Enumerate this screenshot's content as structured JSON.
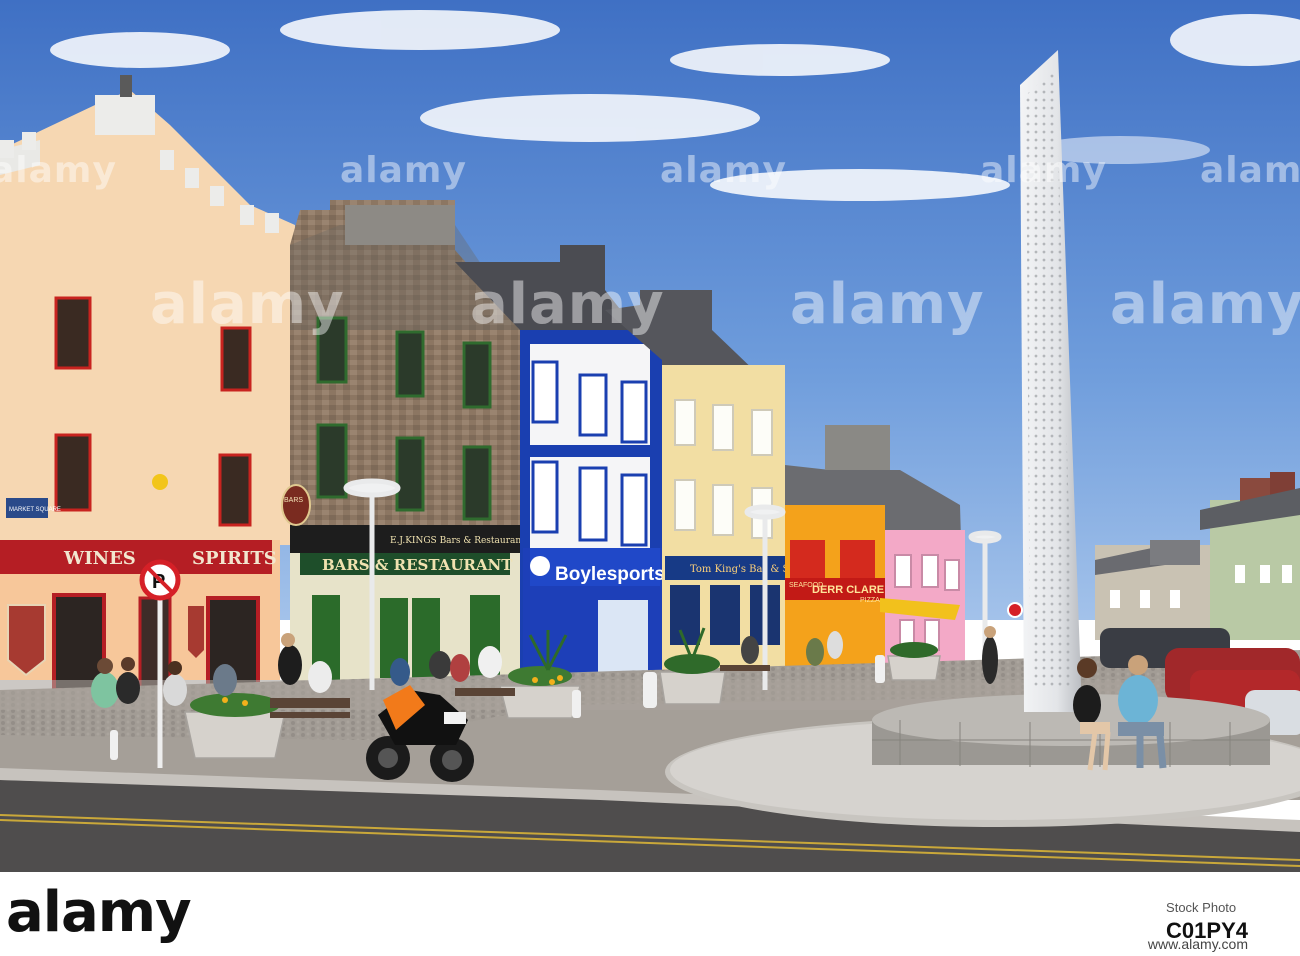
{
  "photo": {
    "description_free": true,
    "signs": {
      "wines": "WINES",
      "spirits": "SPIRITS",
      "ej_kings_panel": "BARS & RESTAURANT",
      "ej_kings_top": "E.J.KINGS Bars & Restaurant",
      "boylesports": "Boylesports.com",
      "kings_bar": "Tom King's Bar & Snug",
      "derr_clare": "DERR CLARE",
      "seafood": "SEAFOOD",
      "pizza": "PIZZA",
      "bars_oval": "BARS",
      "market_square": "MARKET SQUARE"
    }
  },
  "watermarks": [
    "alamy",
    "alamy",
    "alamy",
    "alamy",
    "alamy",
    "alamy",
    "alamy",
    "alamy",
    "alamy"
  ],
  "footer": {
    "logo": "alamy",
    "stock_label": "Stock Photo",
    "stock_code": "C01PY4",
    "site": "www.alamy.com"
  },
  "colors": {
    "sky_top": "#3f74c6",
    "sky_bottom": "#8db4e6",
    "cream_building": "#f6d6b0",
    "stone_building": "#8f7a66",
    "blue_front": "#1a3fb0",
    "yellow_building": "#f2dda0",
    "orange_front": "#f4a21b",
    "pink_front": "#f2a7c6",
    "obelisk": "#e7e9ec",
    "pavement": "#9b9690",
    "road": "#4e4c4c"
  }
}
